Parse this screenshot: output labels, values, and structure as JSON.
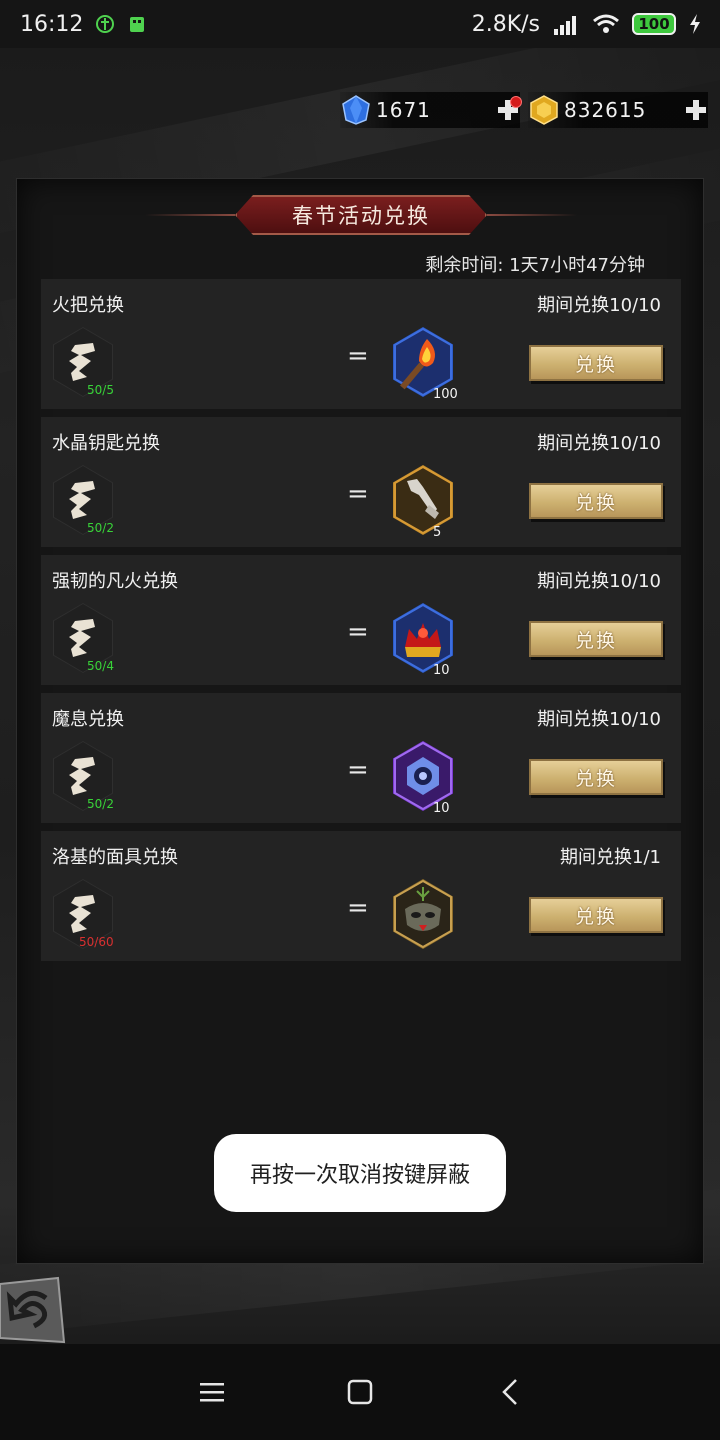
{
  "status_bar": {
    "time": "16:12",
    "net_speed": "2.8K/s",
    "battery": "100"
  },
  "currency": {
    "gems": "1671",
    "gold": "832615"
  },
  "panel": {
    "title": "春节活动兑换",
    "remaining": "剩余时间: 1天7小时47分钟"
  },
  "exchanges": [
    {
      "title": "火把兑换",
      "limit": "期间兑换10/10",
      "need": "50/5",
      "reward_qty": "100",
      "reward_icon": "torch-icon",
      "button": "兑换"
    },
    {
      "title": "水晶钥匙兑换",
      "limit": "期间兑换10/10",
      "need": "50/2",
      "reward_qty": "5",
      "reward_icon": "crystal-key-icon",
      "button": "兑换"
    },
    {
      "title": "强韧的凡火兑换",
      "limit": "期间兑换10/10",
      "need": "50/4",
      "reward_qty": "10",
      "reward_icon": "fire-crown-icon",
      "button": "兑换"
    },
    {
      "title": "魔息兑换",
      "limit": "期间兑换10/10",
      "need": "50/2",
      "reward_qty": "10",
      "reward_icon": "magic-breath-icon",
      "button": "兑换"
    },
    {
      "title": "洛基的面具兑换",
      "limit": "期间兑换1/1",
      "need": "50/60",
      "reward_qty": "",
      "reward_icon": "loki-mask-icon",
      "button": "兑换"
    }
  ],
  "equals_sign": "=",
  "toast": "再按一次取消按键屏蔽",
  "colors": {
    "need_ok": "#38d238",
    "need_insufficient": "#d83030",
    "button_gold": "#cdb170",
    "title_red": "#7a1e1e"
  }
}
